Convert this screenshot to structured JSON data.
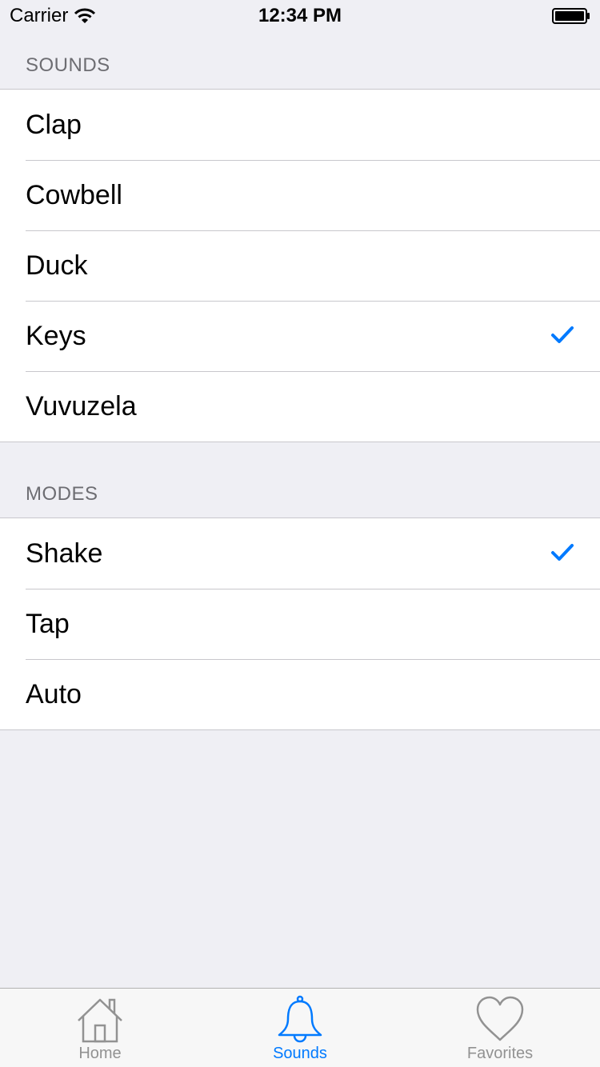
{
  "status_bar": {
    "carrier": "Carrier",
    "time": "12:34 PM"
  },
  "colors": {
    "accent": "#007aff",
    "inactive": "#929292",
    "background": "#efeff4",
    "separator": "#c8c7cc",
    "header_text": "#6d6d72"
  },
  "sounds": {
    "header": "SOUNDS",
    "items": [
      {
        "label": "Clap",
        "checked": false
      },
      {
        "label": "Cowbell",
        "checked": false
      },
      {
        "label": "Duck",
        "checked": false
      },
      {
        "label": "Keys",
        "checked": true
      },
      {
        "label": "Vuvuzela",
        "checked": false
      }
    ]
  },
  "modes": {
    "header": "MODES",
    "items": [
      {
        "label": "Shake",
        "checked": true
      },
      {
        "label": "Tap",
        "checked": false
      },
      {
        "label": "Auto",
        "checked": false
      }
    ]
  },
  "tab_bar": {
    "tabs": [
      {
        "label": "Home",
        "icon": "home-icon",
        "selected": false
      },
      {
        "label": "Sounds",
        "icon": "bell-icon",
        "selected": true
      },
      {
        "label": "Favorites",
        "icon": "heart-icon",
        "selected": false
      }
    ]
  }
}
